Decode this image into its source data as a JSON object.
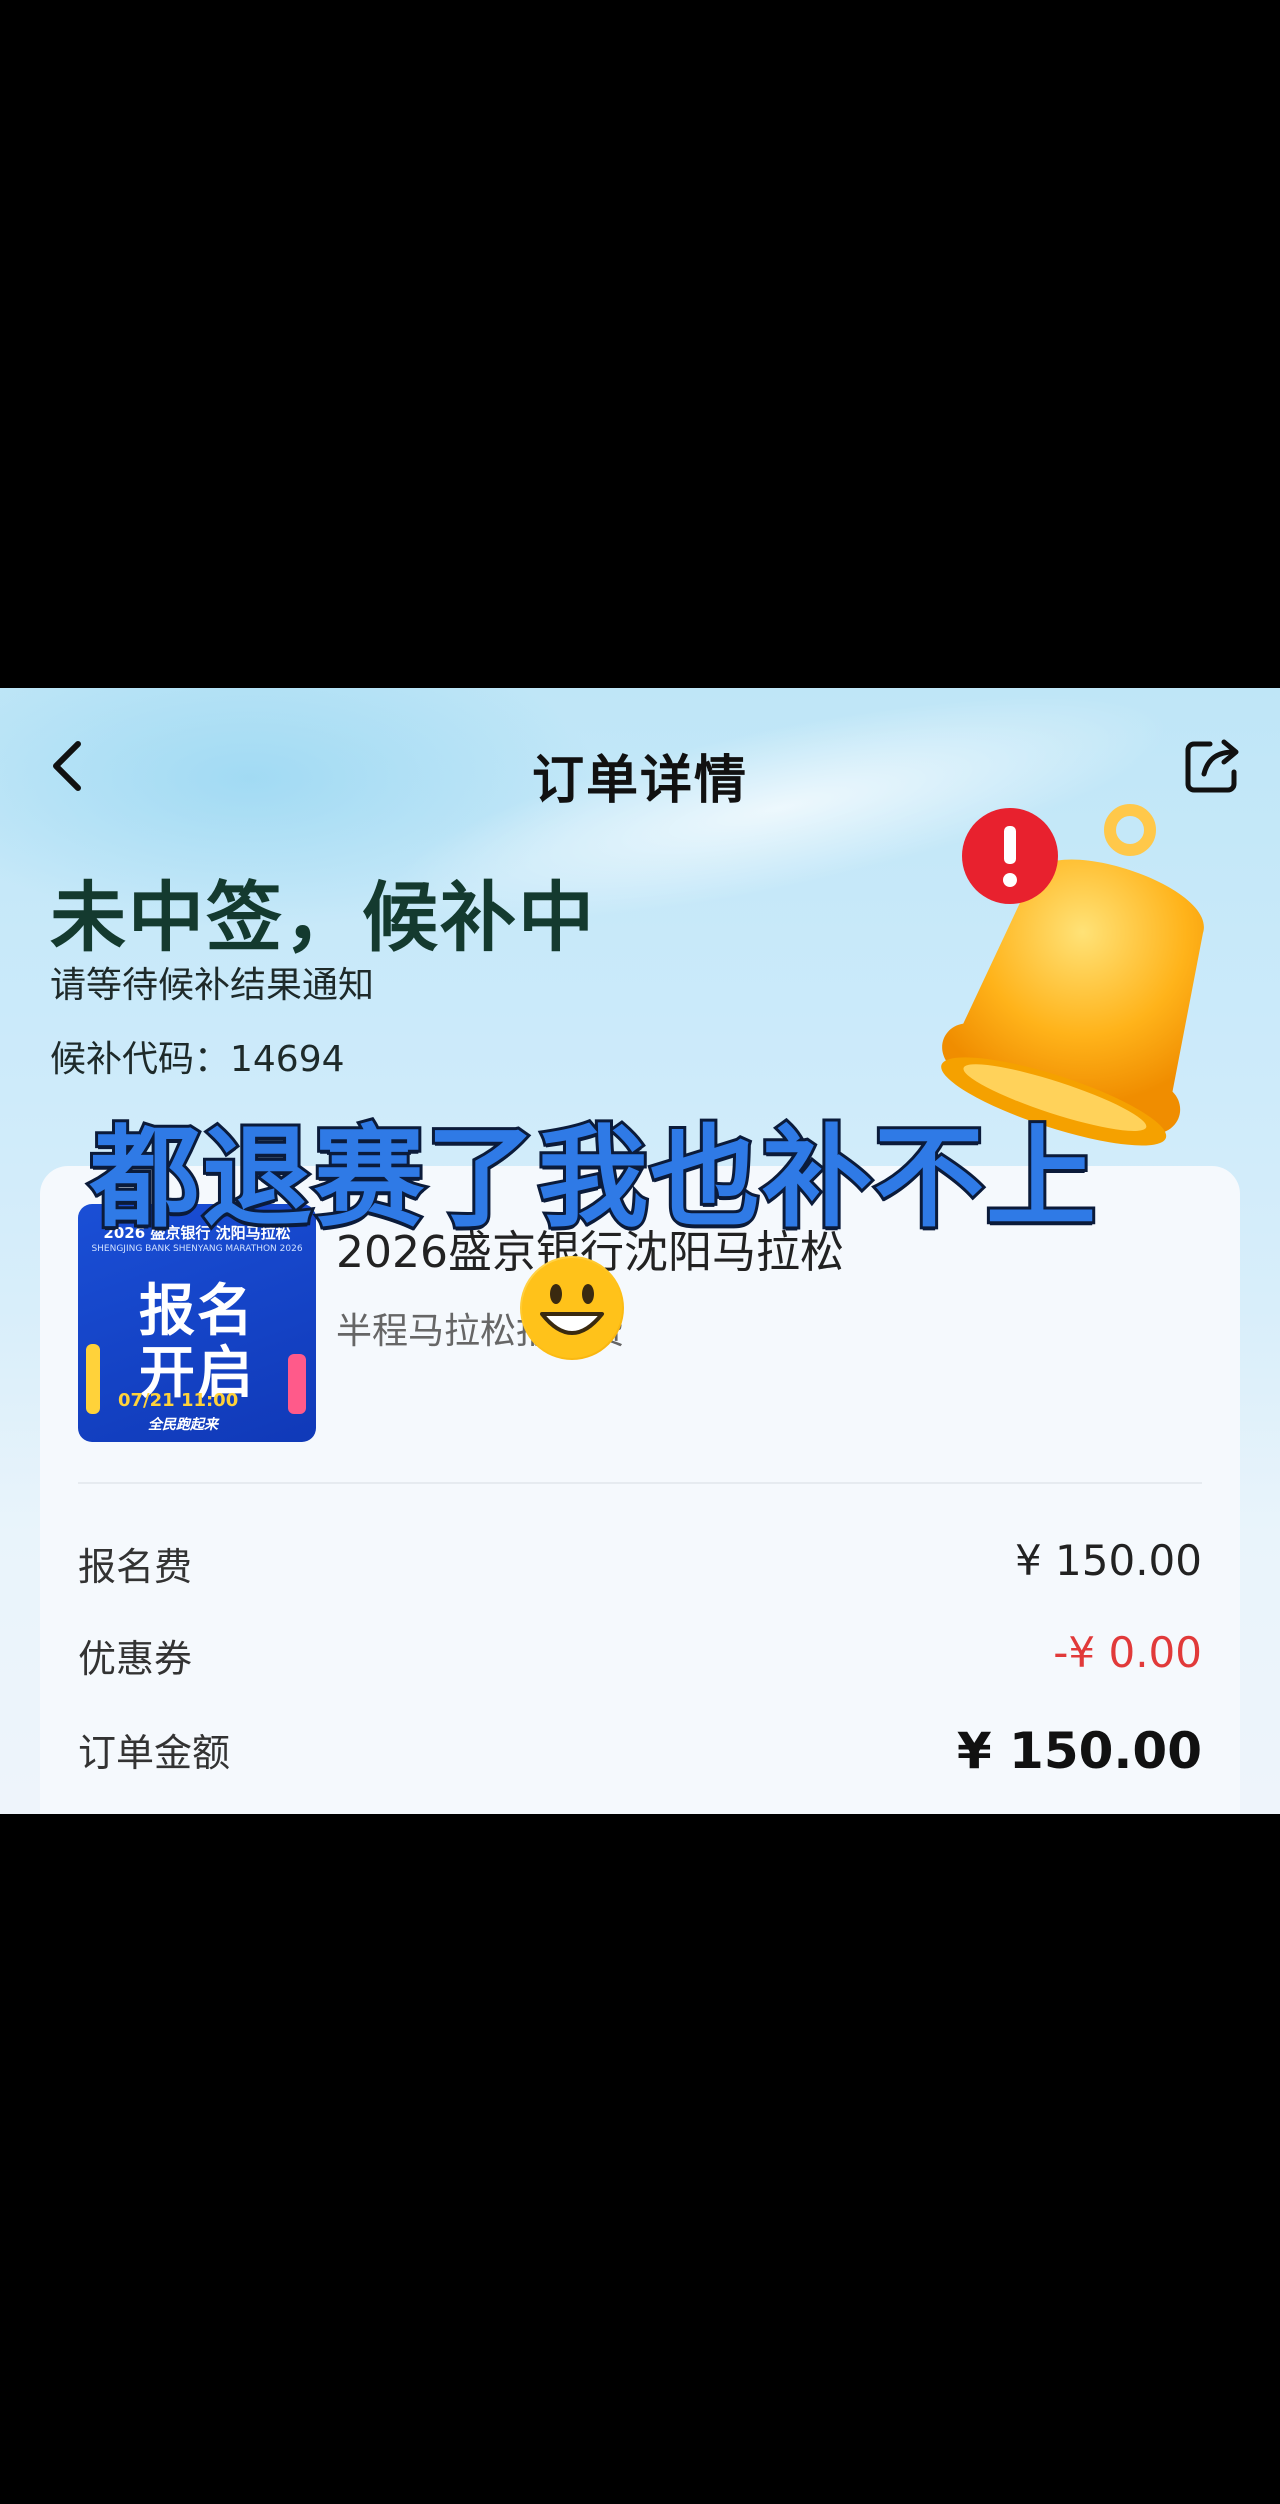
{
  "nav": {
    "title": "订单详情"
  },
  "status": {
    "title": "未中签，候补中",
    "subtitle": "请等待候补结果通知",
    "wait_code": "候补代码：14694"
  },
  "overlay": {
    "caption": "都退赛了我也补不上"
  },
  "event": {
    "title": "2026盛京银行沈阳马拉松",
    "subtitle": "半程马拉松报名费",
    "poster": {
      "line_top": "2026 盛京银行 沈阳马拉松",
      "line_top2": "SHENGJING BANK SHENYANG MARATHON 2026",
      "big1": "报名",
      "big2": "开启",
      "time": "07/21 11:00",
      "foot": "全民跑起来"
    }
  },
  "fees": [
    {
      "label": "报名费",
      "value": "¥ 150.00",
      "style": "normal"
    },
    {
      "label": "优惠券",
      "value": "-¥ 0.00",
      "style": "red"
    },
    {
      "label": "订单金额",
      "value": "¥ 150.00",
      "style": "big"
    }
  ],
  "icons": {
    "back": "chevron-left-icon",
    "share": "share-icon",
    "bell": "bell-alert-icon",
    "emoji": "grinning-face-icon"
  },
  "colors": {
    "discount": "#e13a3a",
    "caption_fill": "#2f7ae6",
    "alert_badge": "#e8212e"
  }
}
